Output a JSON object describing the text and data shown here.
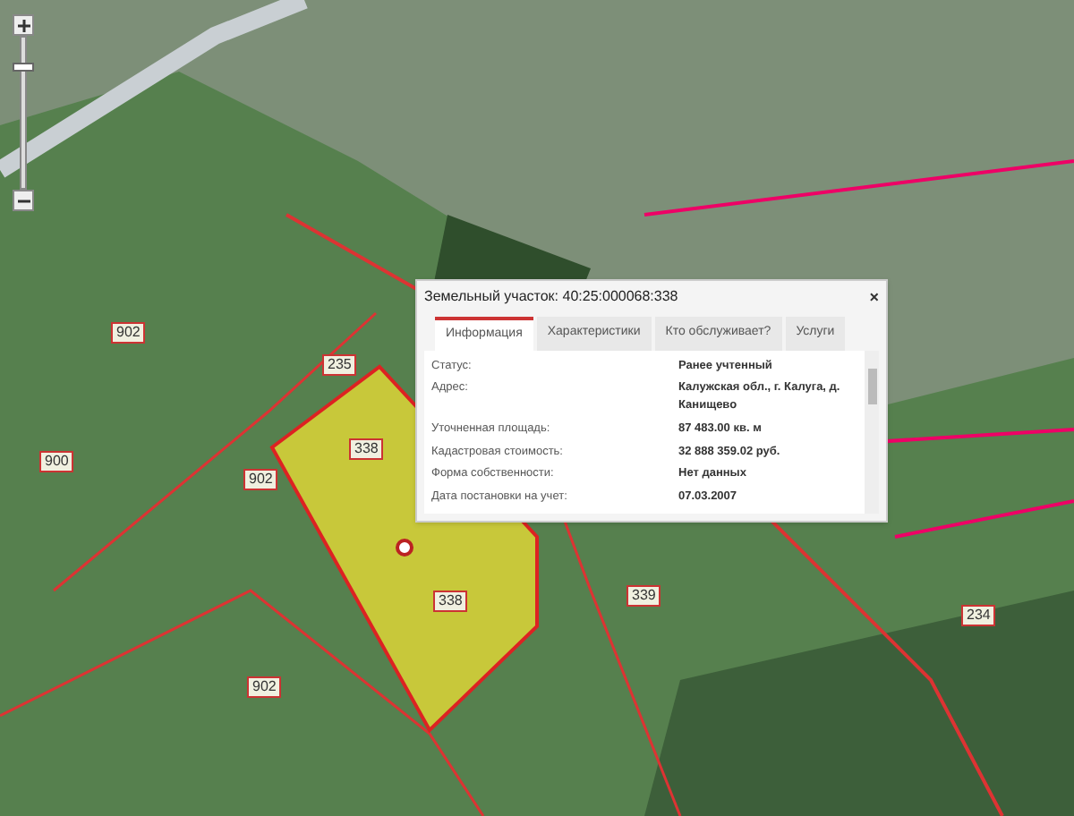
{
  "map": {
    "labels": [
      {
        "text": "338"
      },
      {
        "text": "338"
      },
      {
        "text": "902"
      },
      {
        "text": "900"
      },
      {
        "text": "902"
      },
      {
        "text": "339"
      },
      {
        "text": "235"
      },
      {
        "text": "234"
      },
      {
        "text": "902"
      }
    ]
  },
  "zoom": {
    "level": 0.82
  },
  "popup": {
    "title": "Земельный участок: 40:25:000068:338",
    "close": "×",
    "tabs": [
      {
        "label": "Информация",
        "selected": true
      },
      {
        "label": "Характеристики",
        "selected": false
      },
      {
        "label": "Кто обслуживает?",
        "selected": false
      },
      {
        "label": "Услуги",
        "selected": false
      }
    ],
    "rows": [
      {
        "label": "Статус:",
        "value": "Ранее учтенный"
      },
      {
        "label": "Адрес:",
        "value": "Калужская обл., г. Калуга, д. Канищево"
      },
      {
        "label": "Уточненная площадь:",
        "value": "87 483.00 кв. м"
      },
      {
        "label": "Кадастровая стоимость:",
        "value": "32 888 359.02 руб."
      },
      {
        "label": "Форма собственности:",
        "value": "Нет данных"
      },
      {
        "label": "Дата постановки на учет:",
        "value": "07.03.2007"
      }
    ]
  }
}
